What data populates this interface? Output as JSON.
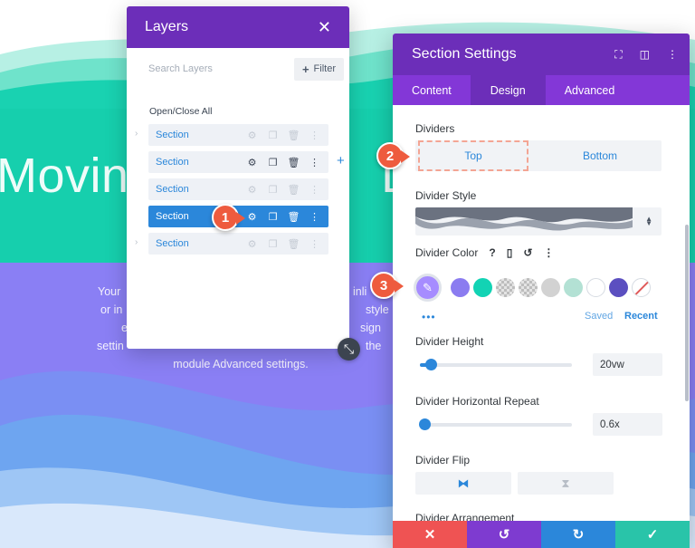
{
  "background": {
    "title": "Moving",
    "title_tail": "Div",
    "body_lines": [
      "Your",
      "or in",
      "eve",
      "settin",
      "module Advanced settings."
    ],
    "body_right": [
      "inli",
      "style",
      "sign",
      "the"
    ]
  },
  "layers": {
    "title": "Layers",
    "search_placeholder": "Search Layers",
    "filter_label": "Filter",
    "open_close_label": "Open/Close All",
    "items": [
      {
        "label": "Section",
        "state": "normal"
      },
      {
        "label": "Section",
        "state": "hover"
      },
      {
        "label": "Section",
        "state": "normal"
      },
      {
        "label": "Section",
        "state": "active"
      },
      {
        "label": "Section",
        "state": "normal"
      }
    ],
    "icons": [
      "gear-icon",
      "duplicate-icon",
      "trash-icon",
      "more-icon"
    ]
  },
  "settings": {
    "title": "Section Settings",
    "tabs": [
      "Content",
      "Design",
      "Advanced"
    ],
    "active_tab": "Design",
    "dividers_label": "Dividers",
    "divider_top": "Top",
    "divider_bottom": "Bottom",
    "divider_style_label": "Divider Style",
    "divider_color_label": "Divider Color",
    "swatch_colors": [
      "#a68cff",
      "#8b7cf0",
      "#12d3b4",
      "checker",
      "checker",
      "#d2d2d2",
      "#b3e1d4",
      "#ffffff",
      "#5b4fc0",
      "none"
    ],
    "saved_label": "Saved",
    "recent_label": "Recent",
    "divider_height_label": "Divider Height",
    "divider_height_value": "20vw",
    "divider_height_fraction": 0.07,
    "divider_repeat_label": "Divider Horizontal Repeat",
    "divider_repeat_value": "0.6x",
    "divider_repeat_fraction": 0.03,
    "divider_flip_label": "Divider Flip",
    "divider_arrangement_label": "Divider Arrangement"
  },
  "footer": {
    "colors": [
      "#ef5353",
      "#7e3bd0",
      "#2b87da",
      "#29c4a9"
    ]
  },
  "badges": [
    "1",
    "2",
    "3"
  ],
  "colors": {
    "purple_header": "#6c2eb9",
    "purple_tabs": "#8337d7",
    "accent_blue": "#2b87da",
    "teal": "#12d3b4",
    "periwinkle": "#8a80f5",
    "badge_orange": "#ee5b3e"
  }
}
